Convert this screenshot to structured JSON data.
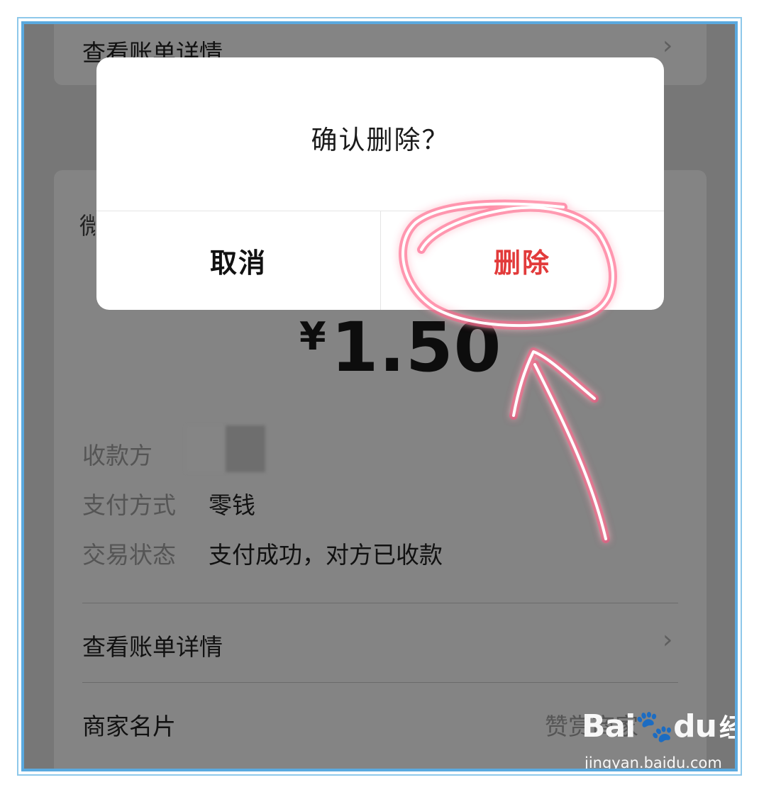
{
  "background_card": {
    "top_row_label": "查看账单详情",
    "partial_title": "微",
    "amount_currency": "¥",
    "amount_value": "1.50",
    "payee_label": "收款方",
    "payment_method_label": "支付方式",
    "payment_method_value": "零钱",
    "status_label": "交易状态",
    "status_value": "支付成功，对方已收款",
    "bill_detail_label": "查看账单详情",
    "merchant_card_label": "商家名片",
    "tip_merchant_label": "赞赏商家"
  },
  "dialog": {
    "title": "确认删除？",
    "cancel_label": "取消",
    "delete_label": "删除"
  },
  "colors": {
    "delete_accent": "#e23b3b",
    "annotation_glow": "#ff3c78",
    "frame_border": "#5aa9df"
  },
  "watermark": {
    "logo": "Bai",
    "logo_tail": "du",
    "brand_cn": "经验",
    "url": "jingyan.baidu.com"
  }
}
